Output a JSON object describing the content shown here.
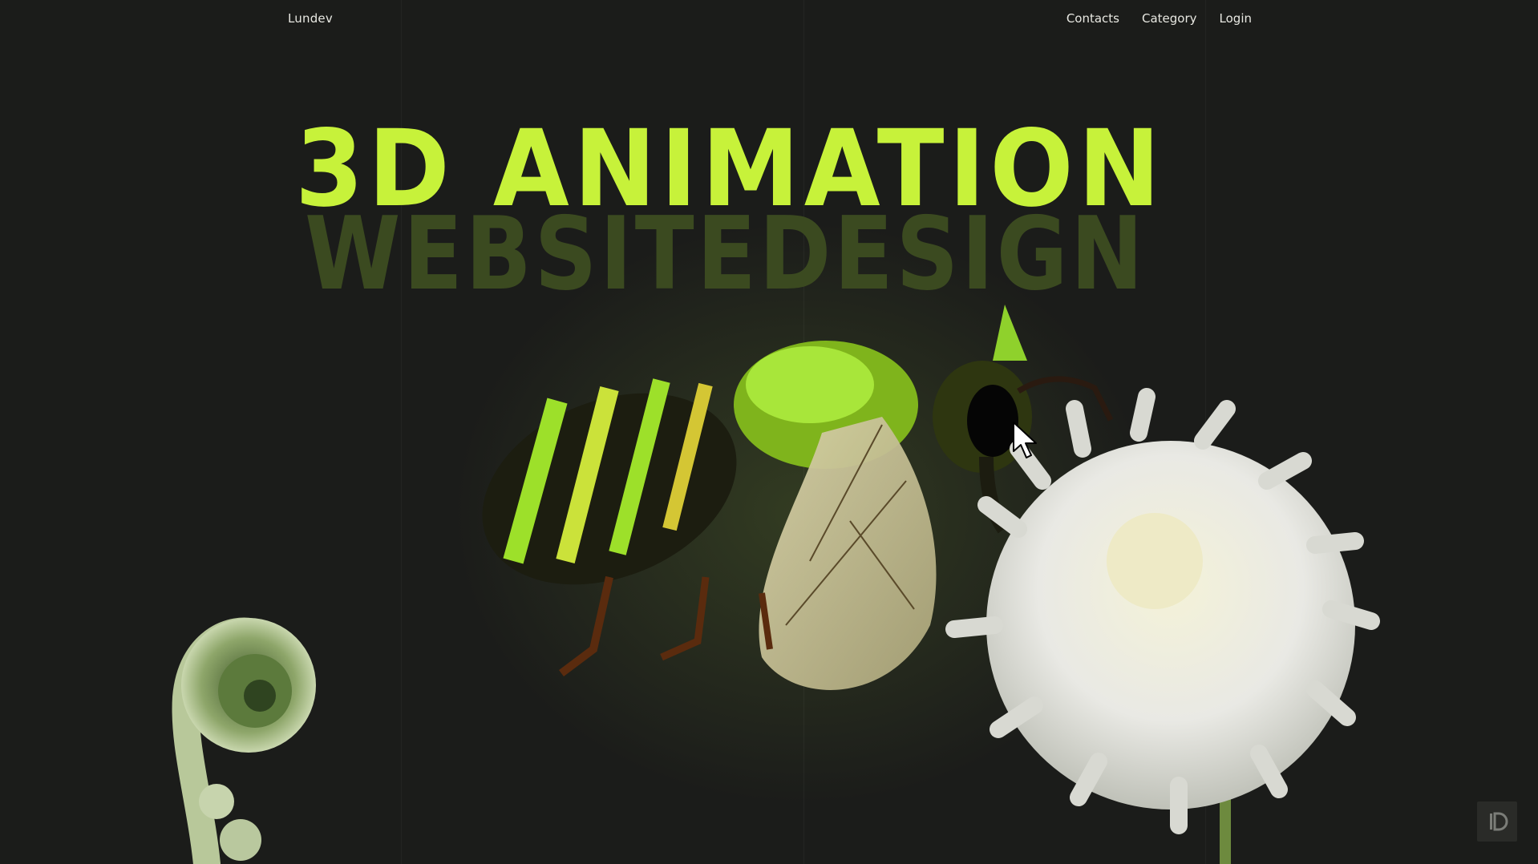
{
  "header": {
    "brand": "Lundev",
    "nav": [
      {
        "label": "Contacts"
      },
      {
        "label": "Category"
      },
      {
        "label": "Login"
      }
    ]
  },
  "hero": {
    "title": "3D ANIMATION",
    "subtitle": "WEBSITEDESIGN"
  },
  "colors": {
    "background": "#1b1c1a",
    "accent": "#c7f23a",
    "subtitle": "#3b4a20",
    "nav_text": "#e8e8e2"
  },
  "icons": {
    "cursor": "mouse-pointer-icon",
    "corner_badge": "app-logo-icon"
  }
}
